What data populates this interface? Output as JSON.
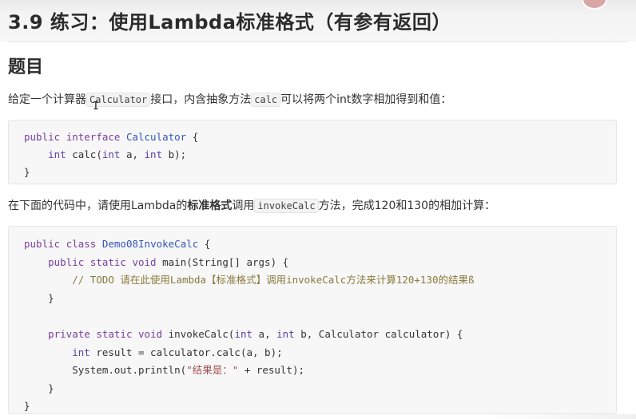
{
  "page": {
    "title": "3.9 练习：使用Lambda标准格式（有参有返回）",
    "section_heading": "题目"
  },
  "para1": {
    "before": "给定一个计算器",
    "code1": "Calculator",
    "middle": "接口，内含抽象方法",
    "code2": "calc",
    "after": "可以将两个int数字相加得到和值："
  },
  "para2": {
    "before": "在下面的代码中，请使用Lambda的",
    "bold": "标准格式",
    "middle": "调用",
    "code": "invokeCalc",
    "after": "方法，完成120和130的相加计算："
  },
  "code_block_1": {
    "line1": {
      "kw1": "public",
      "kw2": "interface",
      "name": "Calculator",
      "rest": " {"
    },
    "line2": {
      "indent": "    ",
      "kw": "int",
      "rest1": " calc(",
      "kw2": "int",
      "rest2": " a, ",
      "kw3": "int",
      "rest3": " b);"
    },
    "line3": {
      "text": "}"
    }
  },
  "code_block_2": {
    "l1": {
      "kw1": "public",
      "kw2": "class",
      "name": "Demo08InvokeCalc",
      "rest": " {"
    },
    "l2": {
      "indent": "    ",
      "kw1": "public",
      "kw2": "static",
      "kw3": "void",
      "rest": " main(String[] args) {"
    },
    "l3": {
      "indent": "        ",
      "comment": "// TODO 请在此使用Lambda【标准格式】调用invokeCalc方法来计算120+130的结果ß"
    },
    "l4": {
      "text": "    }"
    },
    "l5": {
      "text": ""
    },
    "l6": {
      "indent": "    ",
      "kw1": "private",
      "kw2": "static",
      "kw3": "void",
      "rest1": " invokeCalc(",
      "kw4": "int",
      "rest2": " a, ",
      "kw5": "int",
      "rest3": " b, Calculator calculator) {"
    },
    "l7": {
      "indent": "        ",
      "kw": "int",
      "rest": " result = calculator.calc(a, b);"
    },
    "l8": {
      "indent": "        ",
      "pre": "System.out.println(",
      "str": "\"结果是：\"",
      "post": " + result);"
    },
    "l9": {
      "text": "    }"
    },
    "l10": {
      "text": "}"
    }
  }
}
